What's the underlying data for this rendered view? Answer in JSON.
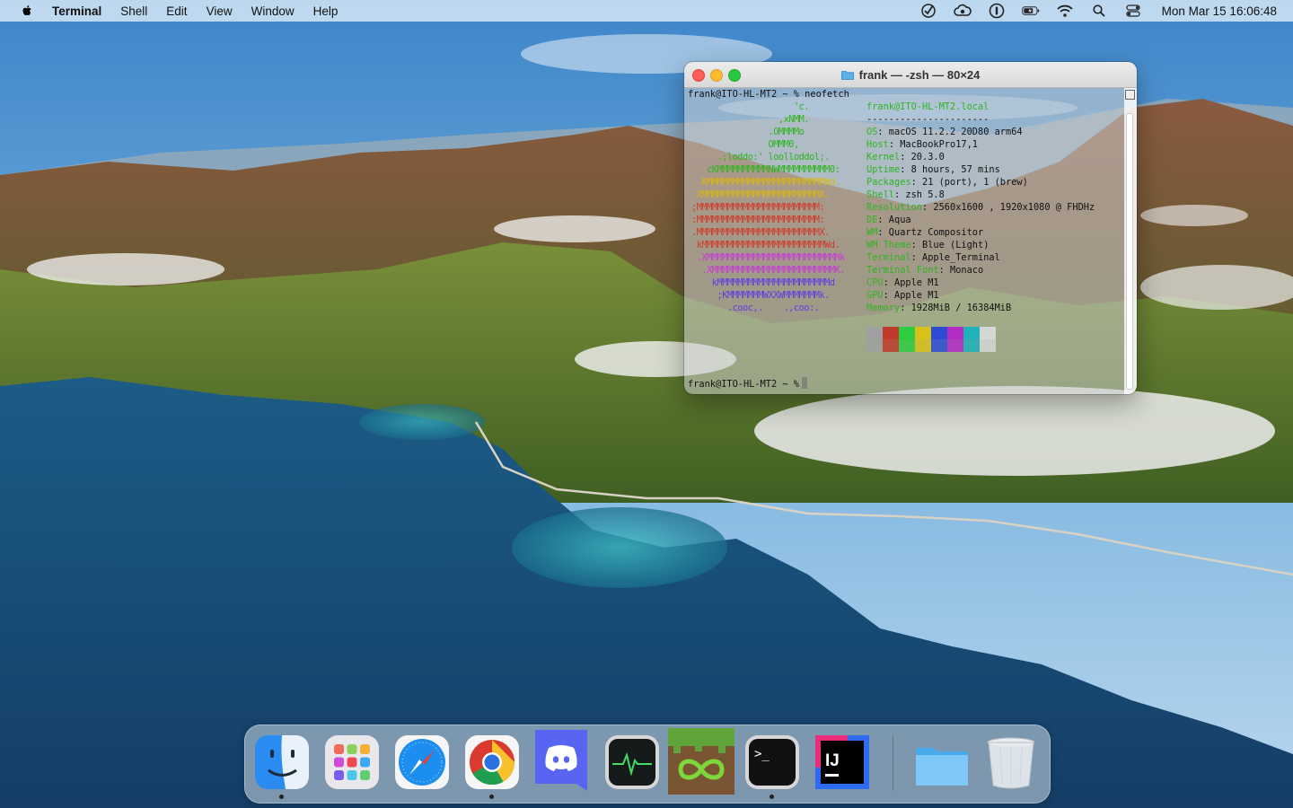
{
  "menubar": {
    "app_name": "Terminal",
    "menus": [
      "Shell",
      "Edit",
      "View",
      "Window",
      "Help"
    ],
    "status_icons": [
      "task-checkmark-icon",
      "creative-cloud-icon",
      "onepassword-icon",
      "battery-charging-icon",
      "wifi-icon",
      "spotlight-search-icon",
      "control-center-icon"
    ],
    "clock": "Mon Mar 15  16:06:48"
  },
  "terminal": {
    "title": "frank — -zsh — 80×24",
    "prompt_command": "frank@ITO-HL-MT2 ~ % neofetch",
    "final_prompt": "frank@ITO-HL-MT2 ~ %",
    "header": "frank@ITO-HL-MT2.local",
    "separator": "----------------------",
    "info": [
      {
        "key": "OS",
        "value": ": macOS 11.2.2 20D80 arm64"
      },
      {
        "key": "Host",
        "value": ": MacBookPro17,1"
      },
      {
        "key": "Kernel",
        "value": ": 20.3.0"
      },
      {
        "key": "Uptime",
        "value": ": 8 hours, 57 mins"
      },
      {
        "key": "Packages",
        "value": ": 21 (port), 1 (brew)"
      },
      {
        "key": "Shell",
        "value": ": zsh 5.8"
      },
      {
        "key": "Resolution",
        "value": ": 2560x1600 , 1920x1080 @ FHDHz"
      },
      {
        "key": "DE",
        "value": ": Aqua"
      },
      {
        "key": "WM",
        "value": ": Quartz Compositor"
      },
      {
        "key": "WM Theme",
        "value": ": Blue (Light)"
      },
      {
        "key": "Terminal",
        "value": ": Apple_Terminal"
      },
      {
        "key": "Terminal Font",
        "value": ": Monaco"
      },
      {
        "key": "CPU",
        "value": ": Apple M1"
      },
      {
        "key": "GPU",
        "value": ": Apple M1"
      },
      {
        "key": "Memory",
        "value": ": 1928MiB / 16384MiB"
      }
    ],
    "ascii_art": [
      {
        "text": "                    'c.",
        "color": "#2fb41f"
      },
      {
        "text": "                 ,xNMM.",
        "color": "#2fb41f"
      },
      {
        "text": "               .OMMMMo",
        "color": "#2fb41f"
      },
      {
        "text": "               OMMM0,",
        "color": "#2fb41f"
      },
      {
        "text": "     .;loddo:' loolloddol;.",
        "color": "#2fb41f"
      },
      {
        "text": "   cKMMMMMMMMMMNWMMMMMMMMMM0:",
        "color": "#2fb41f"
      },
      {
        "text": " .KMMMMMMMMMMMMMMMMMMMMMMMWd.",
        "color": "#d8b70f"
      },
      {
        "text": " XMMMMMMMMMMMMMMMMMMMMMMMX.",
        "color": "#d8b70f"
      },
      {
        "text": ";MMMMMMMMMMMMMMMMMMMMMMMM:",
        "color": "#d03b2a"
      },
      {
        "text": ":MMMMMMMMMMMMMMMMMMMMMMMM:",
        "color": "#d03b2a"
      },
      {
        "text": ".MMMMMMMMMMMMMMMMMMMMMMMMX.",
        "color": "#d03b2a"
      },
      {
        "text": " kMMMMMMMMMMMMMMMMMMMMMMMMWd.",
        "color": "#d03b2a"
      },
      {
        "text": " .XMMMMMMMMMMMMMMMMMMMMMMMMMMk",
        "color": "#c63bd6"
      },
      {
        "text": "  .XMMMMMMMMMMMMMMMMMMMMMMMMK.",
        "color": "#c63bd6"
      },
      {
        "text": "    kMMMMMMMMMMMMMMMMMMMMMMd",
        "color": "#5d3ee0"
      },
      {
        "text": "     ;KMMMMMMMWXXWMMMMMMMk.",
        "color": "#5d3ee0"
      },
      {
        "text": "       .cooc,.    .,coo:.",
        "color": "#5d3ee0"
      }
    ],
    "palette_colors": [
      "#a0a0a0",
      "#c0392b",
      "#2ecc40",
      "#d8c11b",
      "#2e4bd6",
      "#b52bc6",
      "#1fb2b8",
      "#d6d6d6"
    ]
  },
  "dock": {
    "apps": [
      {
        "name": "finder",
        "running": true
      },
      {
        "name": "launchpad",
        "running": false
      },
      {
        "name": "safari",
        "running": false
      },
      {
        "name": "chrome",
        "running": true
      },
      {
        "name": "discord",
        "running": false
      },
      {
        "name": "activity-monitor",
        "running": false
      },
      {
        "name": "minecraft-launcher",
        "running": false
      },
      {
        "name": "terminal",
        "running": true
      },
      {
        "name": "intellij-idea",
        "running": false
      }
    ],
    "right_items": [
      "downloads-folder",
      "trash"
    ]
  }
}
